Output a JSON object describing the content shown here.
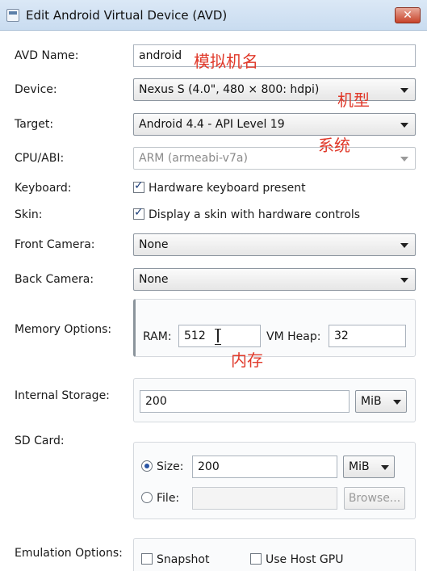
{
  "window": {
    "title": "Edit Android Virtual Device (AVD)",
    "close_label": "✕"
  },
  "avd_name": {
    "label": "AVD Name:",
    "value": "android"
  },
  "device": {
    "label": "Device:",
    "selected": "Nexus S (4.0\", 480 × 800: hdpi)"
  },
  "target": {
    "label": "Target:",
    "selected": "Android 4.4 - API Level 19"
  },
  "cpu_abi": {
    "label": "CPU/ABI:",
    "selected": "ARM (armeabi-v7a)"
  },
  "keyboard": {
    "label": "Keyboard:",
    "checkbox_label": "Hardware keyboard present",
    "checked": true
  },
  "skin": {
    "label": "Skin:",
    "checkbox_label": "Display a skin with hardware controls",
    "checked": true
  },
  "front_camera": {
    "label": "Front Camera:",
    "selected": "None"
  },
  "back_camera": {
    "label": "Back Camera:",
    "selected": "None"
  },
  "memory_options": {
    "label": "Memory Options:",
    "ram_label": "RAM:",
    "ram_value": "512",
    "vm_heap_label": "VM Heap:",
    "vm_heap_value": "32"
  },
  "internal_storage": {
    "label": "Internal Storage:",
    "value": "200",
    "unit": "MiB"
  },
  "sd_card": {
    "label": "SD Card:",
    "size_label": "Size:",
    "size_value": "200",
    "size_unit": "MiB",
    "size_selected": true,
    "file_label": "File:",
    "file_value": "",
    "browse_label": "Browse..."
  },
  "emulation_options": {
    "label": "Emulation Options:",
    "snapshot_label": "Snapshot",
    "host_gpu_label": "Use Host GPU"
  },
  "annotations": {
    "avd_name_note": "模拟机名",
    "device_note": "机型",
    "target_note": "系统",
    "memory_note": "内存"
  },
  "colors": {
    "annotation": "#e0392a",
    "titlebar": "#c9dcf0",
    "close_button": "#c7432a"
  }
}
